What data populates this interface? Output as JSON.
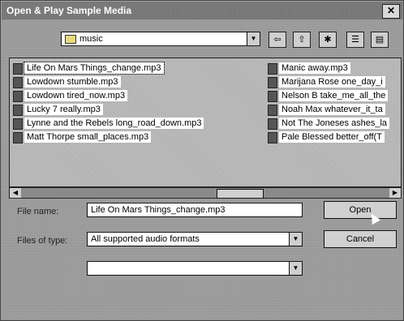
{
  "window": {
    "title": "Open & Play Sample Media"
  },
  "toolbar": {
    "folder": "music",
    "buttons": [
      "back-icon",
      "up-folder-icon",
      "new-folder-icon",
      "list-view-icon",
      "details-view-icon"
    ]
  },
  "files_left": [
    "Life On Mars Things_change.mp3",
    "Lowdown stumble.mp3",
    "Lowdown tired_now.mp3",
    "Lucky 7 really.mp3",
    "Lynne and the Rebels long_road_down.mp3",
    "Matt Thorpe small_places.mp3"
  ],
  "files_right": [
    "Manic away.mp3",
    "Marijana Rose one_day_i",
    "Nelson B take_me_all_the",
    "Noah Max whatever_it_ta",
    "Not The Joneses ashes_la",
    "Pale Blessed better_off(T"
  ],
  "form": {
    "filename_label": "File name:",
    "filename_value": "Life On Mars Things_change.mp3",
    "filetype_label": "Files of type:",
    "filetype_value": "All supported audio formats",
    "third_label": "",
    "third_value": "",
    "open_label": "Open",
    "cancel_label": "Cancel"
  }
}
